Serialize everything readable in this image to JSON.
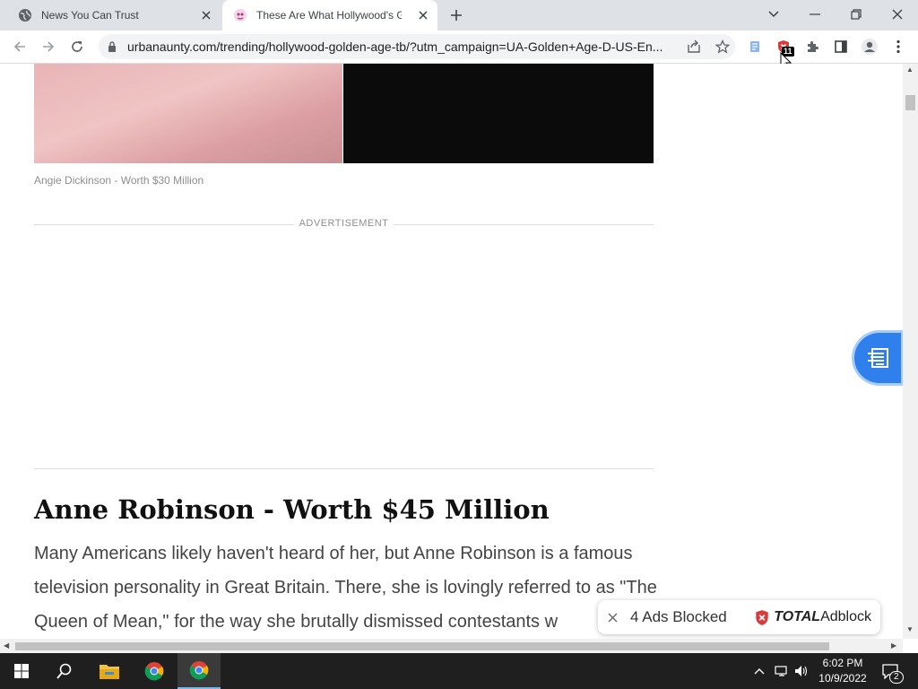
{
  "browser": {
    "tabs": [
      {
        "title": "News You Can Trust",
        "active": false
      },
      {
        "title": "These Are What Hollywood's Golden Age",
        "active": true
      }
    ],
    "url": "urbanaunty.com/trending/hollywood-golden-age-tb/?utm_campaign=UA-Golden+Age-D-US-En...",
    "extension_badge": "11"
  },
  "page": {
    "caption": "Angie Dickinson - Worth $30 Million",
    "ad_label": "ADVERTISEMENT",
    "heading": "Anne Robinson - Worth $45 Million",
    "body": "Many Americans likely haven't heard of her, but Anne Robinson is a famous television personality in Great Britain. There, she is lovingly referred to as \"The Queen of Mean,\" for the way she brutally dismissed contestants w"
  },
  "adblock_toast": {
    "count_text": "4 Ads Blocked",
    "brand_bold": "TOTAL",
    "brand_rest": "Adblock"
  },
  "taskbar": {
    "time": "6:02 PM",
    "date": "10/9/2022",
    "notification_count": "2"
  },
  "colors": {
    "accent": "#2f80ed",
    "adblock_red": "#d93a3a"
  }
}
